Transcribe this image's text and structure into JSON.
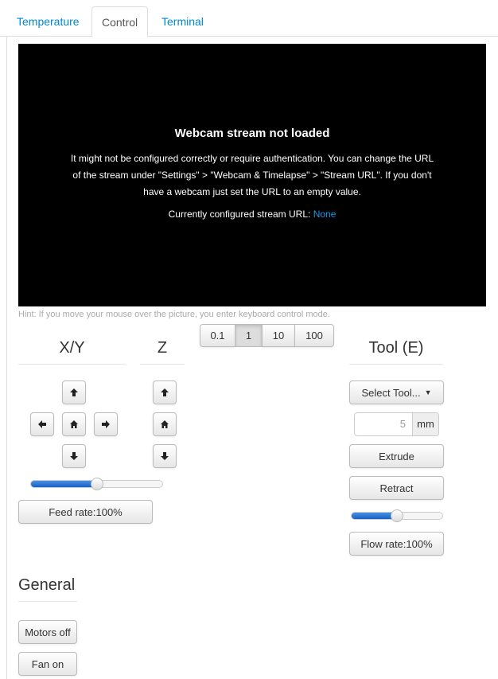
{
  "tabs": [
    "Temperature",
    "Control",
    "Terminal"
  ],
  "webcam": {
    "title": "Webcam stream not loaded",
    "message": "It might not be configured correctly or require authentication. You can change the URL of the stream under \"Settings\" > \"Webcam & Timelapse\" > \"Stream URL\". If you don't have a webcam just set the URL to an empty value.",
    "current_label": "Currently configured stream URL:",
    "current_value": "None"
  },
  "hint": "Hint: If you move your mouse over the picture, you enter keyboard control mode.",
  "distances": [
    "0.1",
    "1",
    "10",
    "100"
  ],
  "headers": {
    "xy": "X/Y",
    "z": "Z",
    "tool": "Tool (E)"
  },
  "feed_rate_label": "Feed rate:100%",
  "feed_rate_value": 0.5,
  "tool": {
    "select_label": "Select Tool...",
    "amount": "5",
    "unit": "mm",
    "extrude": "Extrude",
    "retract": "Retract",
    "flow_rate_label": "Flow rate:100%",
    "flow_rate_value": 0.5
  },
  "general": {
    "title": "General",
    "motors_off": "Motors off",
    "fan_on": "Fan on"
  },
  "colors": {
    "link": "#0088cc",
    "slider": "#1663c7"
  }
}
